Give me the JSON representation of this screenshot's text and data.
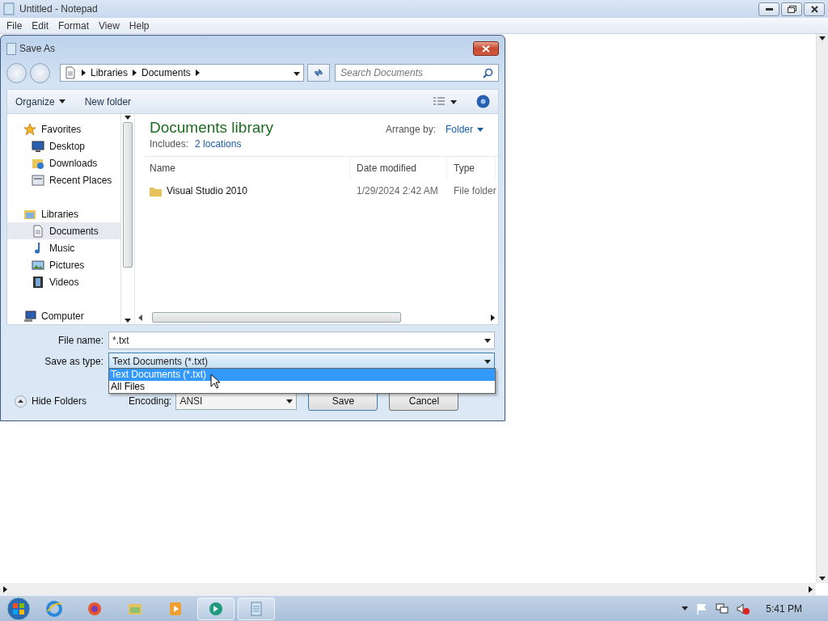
{
  "notepad": {
    "title": "Untitled - Notepad",
    "menu": [
      "File",
      "Edit",
      "Format",
      "View",
      "Help"
    ]
  },
  "dialog": {
    "title": "Save As",
    "breadcrumb": [
      "Libraries",
      "Documents"
    ],
    "search": {
      "placeholder": "Search Documents"
    },
    "toolbar": {
      "organize": "Organize",
      "new_folder": "New folder"
    },
    "nav": [
      {
        "label": "Favorites",
        "kind": "star",
        "selected": false,
        "children": [
          {
            "label": "Desktop",
            "kind": "desktop",
            "selected": false
          },
          {
            "label": "Downloads",
            "kind": "downloads",
            "selected": false
          },
          {
            "label": "Recent Places",
            "kind": "recent",
            "selected": false
          }
        ]
      },
      {
        "label": "Libraries",
        "kind": "library",
        "selected": false,
        "children": [
          {
            "label": "Documents",
            "kind": "document",
            "selected": true
          },
          {
            "label": "Music",
            "kind": "music",
            "selected": false
          },
          {
            "label": "Pictures",
            "kind": "pictures",
            "selected": false
          },
          {
            "label": "Videos",
            "kind": "videos",
            "selected": false
          }
        ]
      },
      {
        "label": "Computer",
        "kind": "computer",
        "selected": false
      }
    ],
    "library": {
      "title": "Documents library",
      "includes_label": "Includes:",
      "includes_link": "2 locations",
      "arrange_label": "Arrange by:",
      "arrange_value": "Folder"
    },
    "table": {
      "columns": [
        "Name",
        "Date modified",
        "Type"
      ],
      "rows": [
        {
          "name": "Visual Studio 2010",
          "date": "1/29/2024 2:42 AM",
          "type": "File folder"
        }
      ]
    },
    "file_name": {
      "label": "File name:",
      "value": "*.txt"
    },
    "save_type": {
      "label": "Save as type:",
      "value": "Text Documents (*.txt)",
      "expanded": true,
      "options": [
        {
          "label": "Text Documents (*.txt)",
          "selected": true
        },
        {
          "label": "All Files",
          "selected": false
        }
      ]
    },
    "encoding": {
      "label": "Encoding:",
      "value": "ANSI"
    },
    "buttons": [
      "Save",
      "Cancel"
    ],
    "hide_folders": "Hide Folders"
  },
  "taskbar": {
    "apps": [
      {
        "kind": "ie",
        "running": false
      },
      {
        "kind": "firefox",
        "running": false
      },
      {
        "kind": "explorer",
        "running": false
      },
      {
        "kind": "media",
        "running": false
      },
      {
        "kind": "globe",
        "running": true
      },
      {
        "kind": "notepad",
        "running": true
      }
    ],
    "clock": "5:41 PM"
  }
}
